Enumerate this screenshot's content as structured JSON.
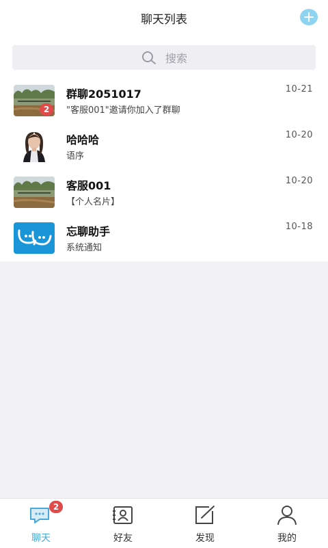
{
  "header": {
    "title": "聊天列表",
    "add_icon": "plus-circle-icon"
  },
  "search": {
    "placeholder": "搜索",
    "icon": "search-icon"
  },
  "conversations": [
    {
      "name": "群聊2051017",
      "message": "\"客服001\"邀请你加入了群聊",
      "time": "10-21",
      "badge": "2",
      "avatar": "landscape-photo"
    },
    {
      "name": "哈哈哈",
      "message": "语序",
      "time": "10-20",
      "avatar": "portrait-photo"
    },
    {
      "name": "客服001",
      "message": "【个人名片】",
      "time": "10-20",
      "avatar": "landscape-photo"
    },
    {
      "name": "忘聊助手",
      "message": "系统通知",
      "time": "10-18",
      "avatar": "assistant-logo"
    }
  ],
  "tabbar": {
    "tabs": [
      {
        "label": "聊天",
        "icon": "chat-icon",
        "badge": "2",
        "active": true
      },
      {
        "label": "好友",
        "icon": "contacts-icon"
      },
      {
        "label": "发现",
        "icon": "discover-icon"
      },
      {
        "label": "我的",
        "icon": "profile-icon"
      }
    ]
  },
  "colors": {
    "accent": "#4aa8d8",
    "badge": "#e04a4a",
    "background": "#f2f2f6"
  }
}
